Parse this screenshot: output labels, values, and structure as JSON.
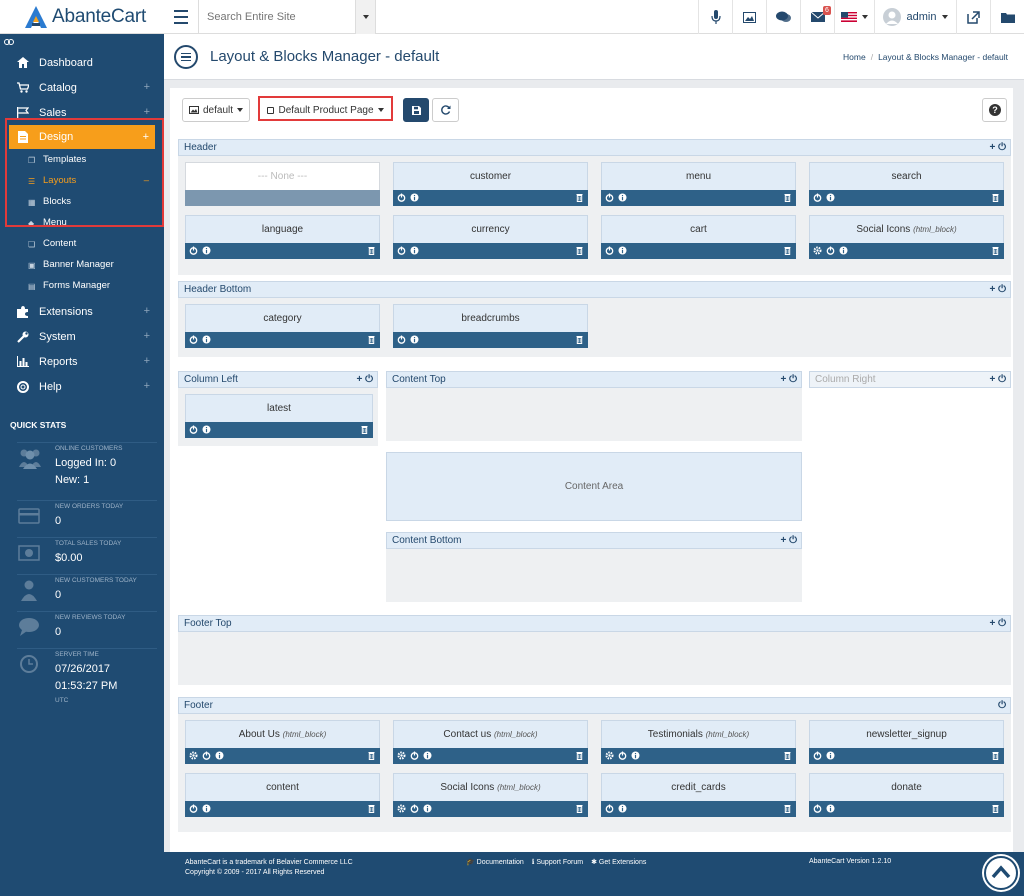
{
  "app": {
    "name": "AbanteCart"
  },
  "topbar": {
    "search_placeholder": "Search Entire Site",
    "messages_count": "6",
    "user": "admin"
  },
  "sidebar": {
    "items": [
      {
        "label": "Dashboard",
        "icon": "home-icon",
        "plus": ""
      },
      {
        "label": "Catalog",
        "icon": "cart-icon",
        "plus": "+"
      },
      {
        "label": "Sales",
        "icon": "flag-icon",
        "plus": "+"
      },
      {
        "label": "Design",
        "icon": "file-icon",
        "plus": "+"
      }
    ],
    "design_sub": [
      {
        "label": "Templates",
        "icon": "template-icon",
        "mark": ""
      },
      {
        "label": "Layouts",
        "icon": "layout-icon",
        "mark": "–"
      },
      {
        "label": "Blocks",
        "icon": "block-icon",
        "mark": ""
      },
      {
        "label": "Menu",
        "icon": "tag-icon",
        "mark": ""
      },
      {
        "label": "Content",
        "icon": "copy-icon",
        "mark": ""
      },
      {
        "label": "Banner Manager",
        "icon": "picture-icon",
        "mark": ""
      },
      {
        "label": "Forms Manager",
        "icon": "forms-icon",
        "mark": ""
      }
    ],
    "items2": [
      {
        "label": "Extensions",
        "icon": "puzzle-icon",
        "plus": "+"
      },
      {
        "label": "System",
        "icon": "wrench-icon",
        "plus": "+"
      },
      {
        "label": "Reports",
        "icon": "chart-icon",
        "plus": "+"
      },
      {
        "label": "Help",
        "icon": "lifebuoy-icon",
        "plus": "+"
      }
    ],
    "quick_stats_title": "QUICK STATS",
    "stats": {
      "online_label": "ONLINE CUSTOMERS",
      "online_logged": "Logged In: 0",
      "online_new": "New: 1",
      "orders_label": "NEW ORDERS TODAY",
      "orders_value": "0",
      "sales_label": "TOTAL SALES TODAY",
      "sales_value": "$0.00",
      "customers_label": "NEW CUSTOMERS TODAY",
      "customers_value": "0",
      "reviews_label": "NEW REVIEWS TODAY",
      "reviews_value": "0",
      "time_label": "SERVER TIME",
      "time_date": "07/26/2017",
      "time_clock": "01:53:27 PM",
      "time_zone": "UTC"
    }
  },
  "page": {
    "title": "Layout & Blocks Manager - default",
    "breadcrumb_home": "Home",
    "breadcrumb_current": "Layout & Blocks Manager - default",
    "template_select": "default",
    "page_select": "Default Product Page"
  },
  "sections": {
    "header": "Header",
    "header_bottom": "Header Bottom",
    "column_left": "Column Left",
    "content_top": "Content Top",
    "column_right": "Column Right",
    "content_area": "Content Area",
    "content_bottom": "Content Bottom",
    "footer_top": "Footer Top",
    "footer": "Footer",
    "add": "+",
    "power": "⏻"
  },
  "blocks": {
    "header": [
      {
        "name": "--- None ---",
        "tag": ""
      },
      {
        "name": "customer",
        "tag": ""
      },
      {
        "name": "menu",
        "tag": ""
      },
      {
        "name": "search",
        "tag": ""
      },
      {
        "name": "language",
        "tag": ""
      },
      {
        "name": "currency",
        "tag": ""
      },
      {
        "name": "cart",
        "tag": ""
      },
      {
        "name": "Social Icons",
        "tag": "(html_block)"
      }
    ],
    "header_bottom": [
      {
        "name": "category",
        "tag": ""
      },
      {
        "name": "breadcrumbs",
        "tag": ""
      }
    ],
    "column_left": [
      {
        "name": "latest",
        "tag": ""
      }
    ],
    "footer": [
      {
        "name": "About Us",
        "tag": "(html_block)"
      },
      {
        "name": "Contact us",
        "tag": "(html_block)"
      },
      {
        "name": "Testimonials",
        "tag": "(html_block)"
      },
      {
        "name": "newsletter_signup",
        "tag": ""
      },
      {
        "name": "content",
        "tag": ""
      },
      {
        "name": "Social Icons",
        "tag": "(html_block)"
      },
      {
        "name": "credit_cards",
        "tag": ""
      },
      {
        "name": "donate",
        "tag": ""
      }
    ]
  },
  "footer": {
    "line1": "AbanteCart is a trademark of Belavier Commerce LLC",
    "line2": "Copyright © 2009 - 2017 All Rights Reserved",
    "doc": "Documentation",
    "forum": "Support Forum",
    "ext": "Get Extensions",
    "version": "AbanteCart Version 1.2.10"
  },
  "colors": {
    "sidebar": "#1f4b72",
    "accent": "#f79e1b",
    "block_bar": "#2e6188",
    "highlight": "#e23a3a"
  }
}
